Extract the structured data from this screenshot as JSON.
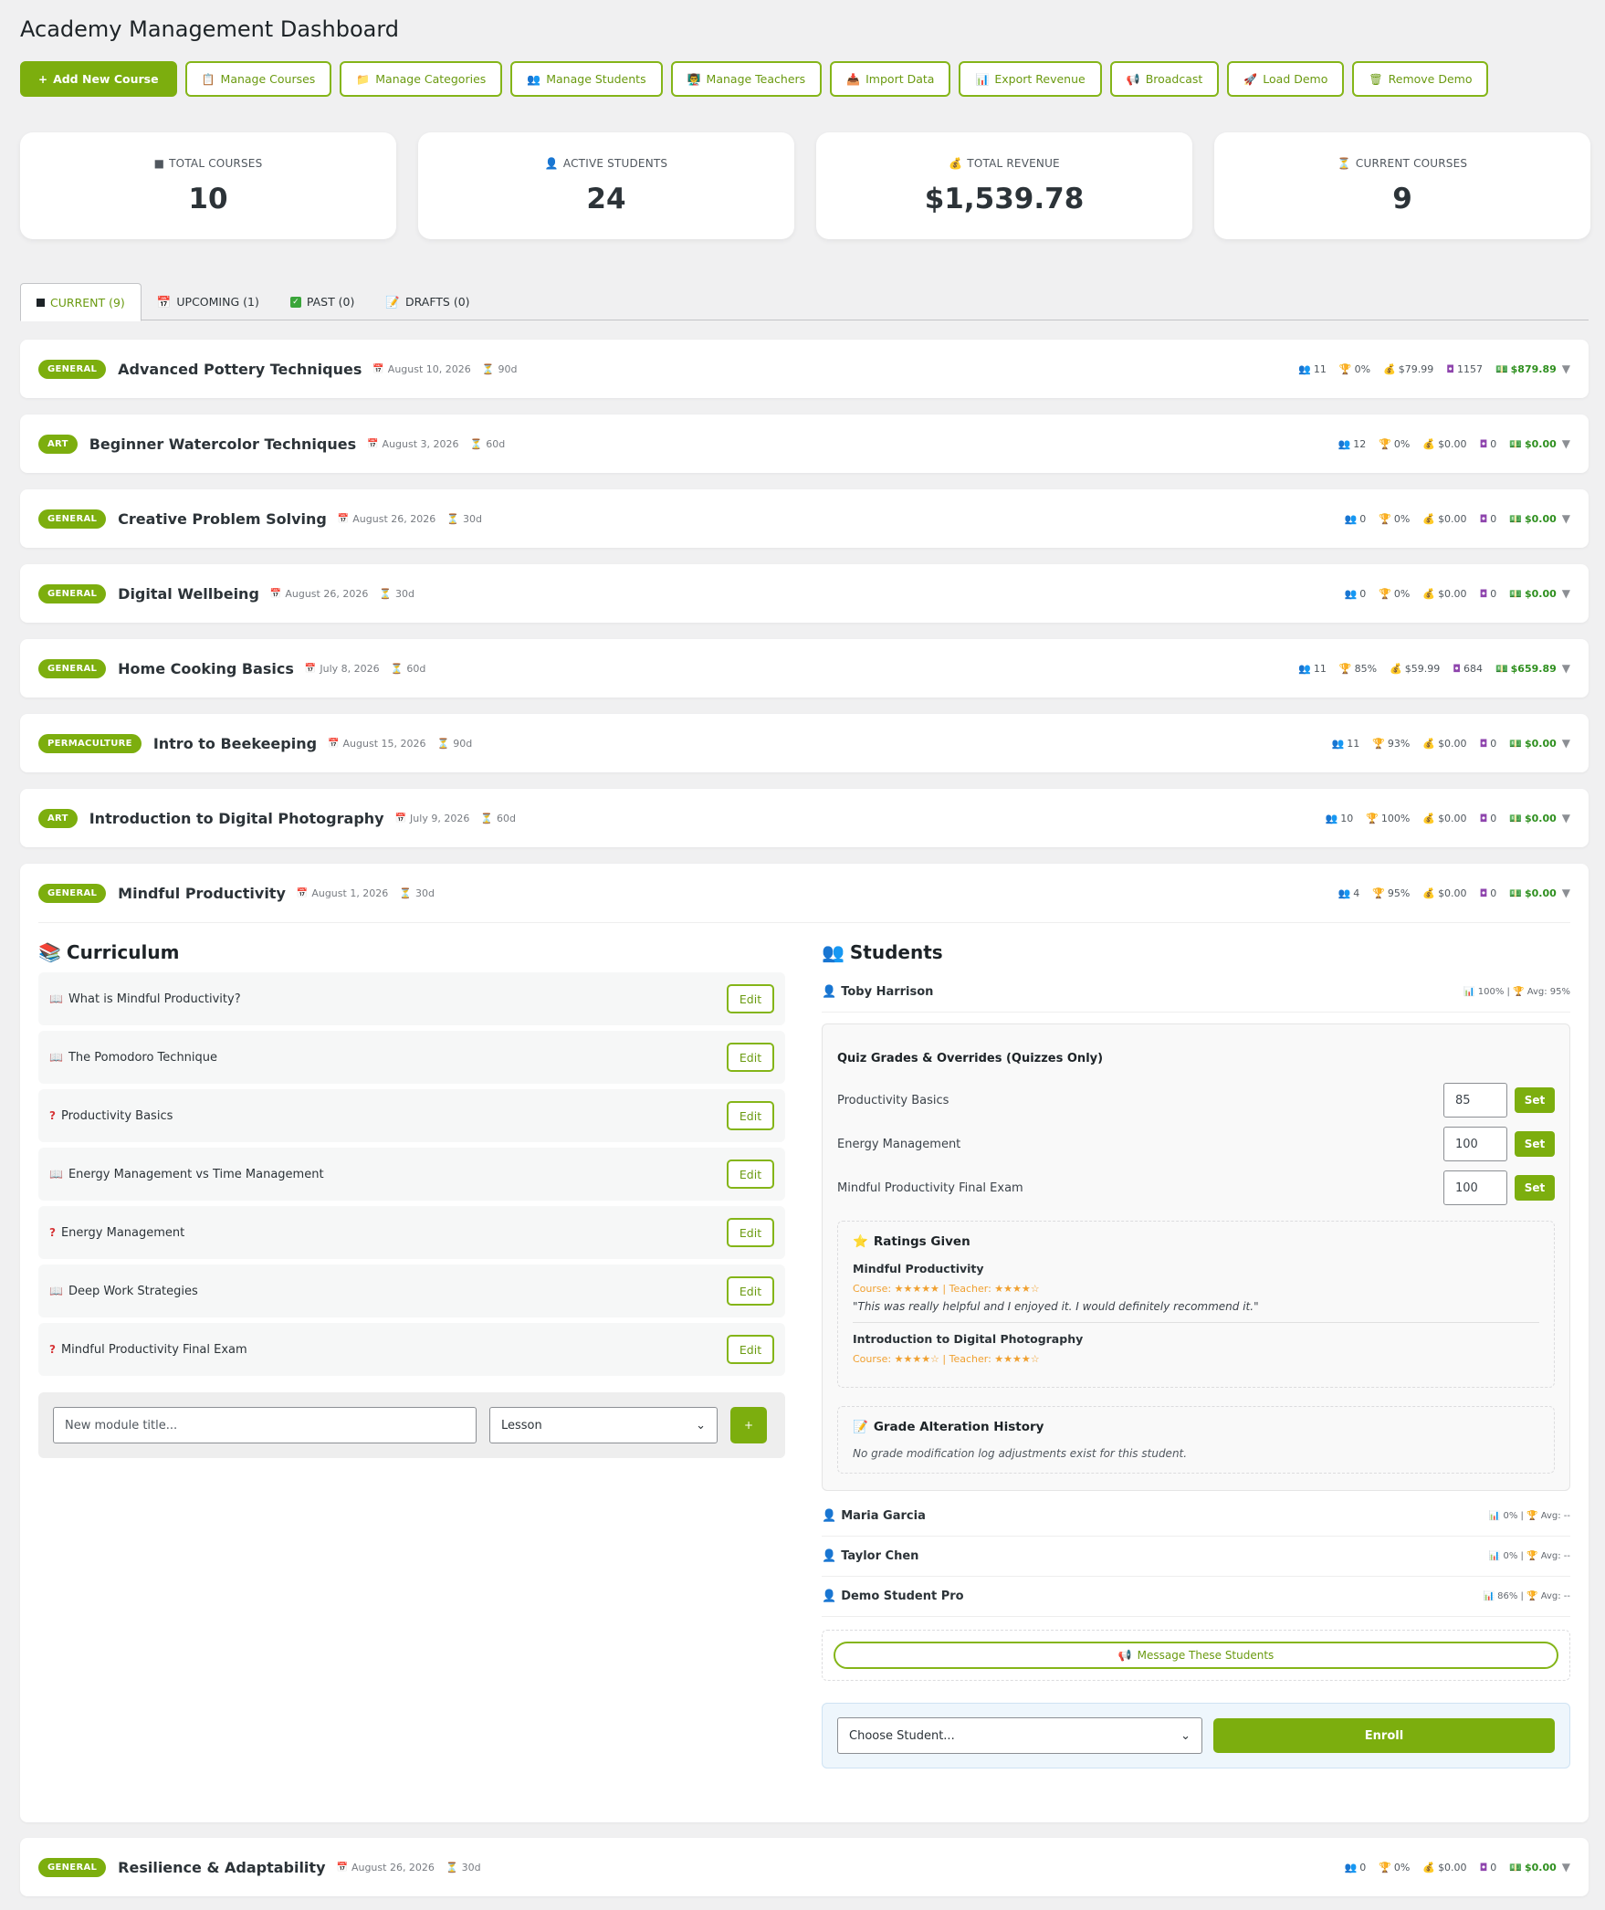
{
  "page_title": "Academy Management Dashboard",
  "toolbar": [
    {
      "icon": "+",
      "label": "Add New Course",
      "primary": true
    },
    {
      "icon": "📋",
      "label": "Manage Courses"
    },
    {
      "icon": "📁",
      "label": "Manage Categories"
    },
    {
      "icon": "👥",
      "label": "Manage Students"
    },
    {
      "icon": "👨‍🏫",
      "label": "Manage Teachers"
    },
    {
      "icon": "📥",
      "label": "Import Data"
    },
    {
      "icon": "📊",
      "label": "Export Revenue"
    },
    {
      "icon": "📢",
      "label": "Broadcast"
    },
    {
      "icon": "🚀",
      "label": "Load Demo"
    },
    {
      "icon": "🗑",
      "label": "Remove Demo"
    }
  ],
  "stats": [
    {
      "icon": "■",
      "label": "TOTAL COURSES",
      "value": "10"
    },
    {
      "icon": "👤",
      "label": "ACTIVE STUDENTS",
      "value": "24"
    },
    {
      "icon": "💰",
      "label": "TOTAL REVENUE",
      "value": "$1,539.78"
    },
    {
      "icon": "⏳",
      "label": "CURRENT COURSES",
      "value": "9"
    }
  ],
  "tabs": [
    {
      "icon": "square",
      "label": "CURRENT (9)",
      "active": true
    },
    {
      "icon": "📅",
      "label": "UPCOMING (1)"
    },
    {
      "icon": "check",
      "label": "PAST (0)"
    },
    {
      "icon": "📝",
      "label": "DRAFTS (0)"
    }
  ],
  "courses": [
    {
      "category": "GENERAL",
      "title": "Advanced Pottery Techniques",
      "date": "August 10, 2026",
      "duration": "90d",
      "students": "11",
      "completion": "0%",
      "price": "$79.99",
      "views": "1157",
      "revenue": "$879.89"
    },
    {
      "category": "ART",
      "title": "Beginner Watercolor Techniques",
      "date": "August 3, 2026",
      "duration": "60d",
      "students": "12",
      "completion": "0%",
      "price": "$0.00",
      "views": "0",
      "revenue": "$0.00"
    },
    {
      "category": "GENERAL",
      "title": "Creative Problem Solving",
      "date": "August 26, 2026",
      "duration": "30d",
      "students": "0",
      "completion": "0%",
      "price": "$0.00",
      "views": "0",
      "revenue": "$0.00"
    },
    {
      "category": "GENERAL",
      "title": "Digital Wellbeing",
      "date": "August 26, 2026",
      "duration": "30d",
      "students": "0",
      "completion": "0%",
      "price": "$0.00",
      "views": "0",
      "revenue": "$0.00"
    },
    {
      "category": "GENERAL",
      "title": "Home Cooking Basics",
      "date": "July 8, 2026",
      "duration": "60d",
      "students": "11",
      "completion": "85%",
      "price": "$59.99",
      "views": "684",
      "revenue": "$659.89"
    },
    {
      "category": "PERMACULTURE",
      "title": "Intro to Beekeeping",
      "date": "August 15, 2026",
      "duration": "90d",
      "students": "11",
      "completion": "93%",
      "price": "$0.00",
      "views": "0",
      "revenue": "$0.00"
    },
    {
      "category": "ART",
      "title": "Introduction to Digital Photography",
      "date": "July 9, 2026",
      "duration": "60d",
      "students": "10",
      "completion": "100%",
      "price": "$0.00",
      "views": "0",
      "revenue": "$0.00"
    },
    {
      "category": "GENERAL",
      "title": "Mindful Productivity",
      "date": "August 1, 2026",
      "duration": "30d",
      "students": "4",
      "completion": "95%",
      "price": "$0.00",
      "views": "0",
      "revenue": "$0.00"
    },
    {
      "category": "GENERAL",
      "title": "Resilience & Adaptability",
      "date": "August 26, 2026",
      "duration": "30d",
      "students": "0",
      "completion": "0%",
      "price": "$0.00",
      "views": "0",
      "revenue": "$0.00"
    }
  ],
  "expanded": {
    "curriculum_title": "Curriculum",
    "edit_label": "Edit",
    "modules": [
      {
        "type": "lesson",
        "title": "What is Mindful Productivity?"
      },
      {
        "type": "lesson",
        "title": "The Pomodoro Technique"
      },
      {
        "type": "quiz",
        "title": "Productivity Basics"
      },
      {
        "type": "lesson",
        "title": "Energy Management vs Time Management"
      },
      {
        "type": "quiz",
        "title": "Energy Management"
      },
      {
        "type": "lesson",
        "title": "Deep Work Strategies"
      },
      {
        "type": "quiz",
        "title": "Mindful Productivity Final Exam"
      }
    ],
    "new_module_placeholder": "New module title...",
    "module_type": "Lesson",
    "add_label": "+",
    "students_title": "Students",
    "students": [
      {
        "name": "Toby Harrison",
        "progress": "100%",
        "avg": "Avg: 95%"
      },
      {
        "name": "Maria Garcia",
        "progress": "0%",
        "avg": "Avg: --"
      },
      {
        "name": "Taylor Chen",
        "progress": "0%",
        "avg": "Avg: --"
      },
      {
        "name": "Demo Student Pro",
        "progress": "86%",
        "avg": "Avg: --"
      }
    ],
    "quiz_grades_title": "Quiz Grades & Overrides (Quizzes Only)",
    "set_label": "Set",
    "quiz_grades": [
      {
        "quiz": "Productivity Basics",
        "grade": "85"
      },
      {
        "quiz": "Energy Management",
        "grade": "100"
      },
      {
        "quiz": "Mindful Productivity Final Exam",
        "grade": "100"
      }
    ],
    "ratings_title": "Ratings Given",
    "ratings": [
      {
        "course": "Mindful Productivity",
        "stars": "Course: ★★★★★ | Teacher: ★★★★☆",
        "comment": "\"This was really helpful and I enjoyed it. I would definitely recommend it.\""
      },
      {
        "course": "Introduction to Digital Photography",
        "stars": "Course: ★★★★☆ | Teacher: ★★★★☆",
        "comment": ""
      }
    ],
    "history_title": "Grade Alteration History",
    "history_empty": "No grade modification log adjustments exist for this student.",
    "message_label": "Message These Students",
    "choose_student": "Choose Student...",
    "enroll_label": "Enroll"
  }
}
